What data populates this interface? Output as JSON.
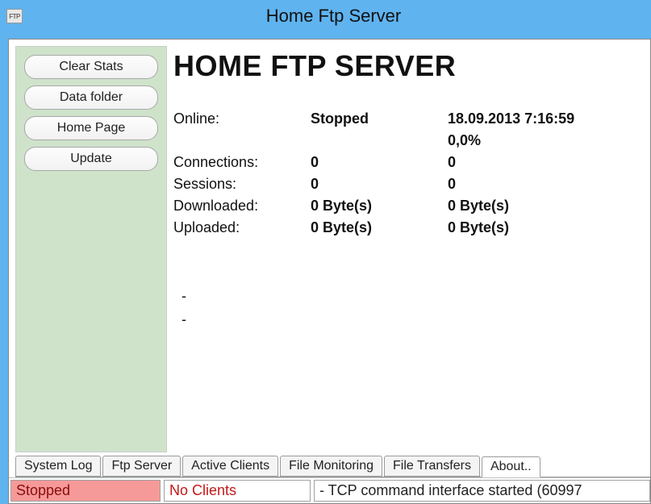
{
  "window": {
    "icon_text": "FTP",
    "title": "Home Ftp Server"
  },
  "sidebar": {
    "buttons": {
      "clear_stats": "Clear Stats",
      "data_folder": "Data folder",
      "home_page": "Home Page",
      "update": "Update"
    }
  },
  "content": {
    "title": "HOME FTP SERVER",
    "rows": {
      "online_label": "Online:",
      "online_value": "Stopped",
      "online_time": "18.09.2013 7:16:59",
      "percent": "0,0%",
      "connections_label": "Connections:",
      "connections_val": "0",
      "connections_right": "0",
      "sessions_label": "Sessions:",
      "sessions_val": "0",
      "sessions_right": "0",
      "downloaded_label": "Downloaded:",
      "downloaded_val": "0 Byte(s)",
      "downloaded_right": "0 Byte(s)",
      "uploaded_label": "Uploaded:",
      "uploaded_val": "0 Byte(s)",
      "uploaded_right": "0 Byte(s)"
    },
    "dash1": "-",
    "dash2": "-"
  },
  "tabs": {
    "system_log": "System Log",
    "ftp_server": "Ftp Server",
    "active_clients": "Active Clients",
    "file_monitoring": "File Monitoring",
    "file_transfers": "File Transfers",
    "about": "About.."
  },
  "status": {
    "stopped": "Stopped",
    "clients": "No Clients",
    "log": "- TCP command interface started (60997"
  }
}
